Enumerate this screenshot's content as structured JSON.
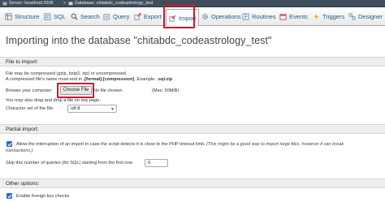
{
  "breadcrumb": {
    "server": "Server: localhost:3306",
    "database": "Database: chitabdc_codeastrology_test",
    "separator": "»"
  },
  "tabs": [
    {
      "label": "Structure",
      "icon": "structure-icon"
    },
    {
      "label": "SQL",
      "icon": "sql-icon"
    },
    {
      "label": "Search",
      "icon": "search-icon"
    },
    {
      "label": "Query",
      "icon": "query-icon"
    },
    {
      "label": "Export",
      "icon": "export-icon"
    },
    {
      "label": "Import",
      "icon": "import-icon"
    },
    {
      "label": "Operations",
      "icon": "operations-icon"
    },
    {
      "label": "Routines",
      "icon": "routines-icon"
    },
    {
      "label": "Events",
      "icon": "events-icon"
    },
    {
      "label": "Triggers",
      "icon": "triggers-icon"
    },
    {
      "label": "Designer",
      "icon": "designer-icon"
    }
  ],
  "page_title": "Importing into the database \"chitabdc_codeastrology_test\"",
  "file_section": {
    "legend": "File to import:",
    "line1": "File may be compressed (gzip, bzip2, zip) or uncompressed.",
    "line2_prefix": "A compressed file's name must end in ",
    "line2_bold": ".[format].[compression]",
    "line2_suffix": ". Example: ",
    "line2_example": ".sql.zip",
    "browse_label": "Browse your computer:",
    "choose_button": "Choose File",
    "no_file": "No file chosen",
    "max_size": "(Max: 50MiB)",
    "drag_text": "You may also drag and drop a file on any page.",
    "charset_label": "Character set of the file:",
    "charset_value": "utf-8"
  },
  "partial_section": {
    "legend": "Partial import:",
    "interrupt_text": "Allow the interruption of an import in case the script detects it is close to the PHP timeout limit.",
    "interrupt_hint_1": "(This might be a good way to import large files, however it can break",
    "interrupt_hint_2": "transactions.)",
    "skip_label": "Skip this number of queries (for SQL) starting from the first one:",
    "skip_value": "0"
  },
  "other_section": {
    "legend": "Other options:",
    "fk_text": "Enable foreign key checks"
  },
  "colors": {
    "highlight": "#d2152a",
    "link": "#235a81",
    "checkbox": "#2a6cd1"
  }
}
